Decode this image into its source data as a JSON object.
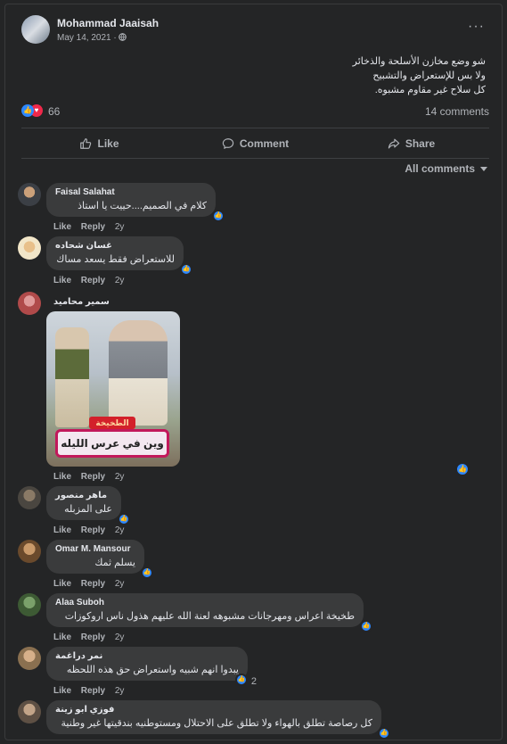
{
  "post": {
    "author": "Mohammad Jaaisah",
    "date": "May 14, 2021 · ",
    "globe_icon": "globe-icon",
    "more_label": "···",
    "lines": [
      "شو وضع مخازن الأسلحة والذخائر",
      "ولا بس للإستعراض والتشبيح",
      "كل سلاح غير مقاوم مشبوه."
    ],
    "reactions_count": "66",
    "comments_count": "14 comments"
  },
  "actions": {
    "like": "Like",
    "comment": "Comment",
    "share": "Share"
  },
  "filter": {
    "label": "All comments"
  },
  "comment_actions": {
    "like": "Like",
    "reply": "Reply",
    "time": "2y"
  },
  "comments": [
    {
      "name": "Faisal Salahat",
      "text": "كلام في الصميم....حييت يا استاذ"
    },
    {
      "name": "غسان شحاده",
      "text": "للاستعراض فقط يسعد مساك"
    },
    {
      "name": "سمير محاميد",
      "text": "",
      "image_text": "وين في عرس الليله",
      "image_badge": "الطخيخة"
    },
    {
      "name": "ماهر منصور",
      "text": "على المزبله"
    },
    {
      "name": "Omar M. Mansour",
      "text": "يسلم ثمك"
    },
    {
      "name": "Alaa Suboh",
      "text": "طخيخة اعراس ومهرجانات مشبوهه لعنة الله عليهم هذول ناس اروكوزات"
    },
    {
      "name": "نمر دراغمة",
      "text": "يبدوا انهم شبيه واستعراض حق هذه اللحظه",
      "reaction_count": "2"
    },
    {
      "name": "فوزي ابو زينة",
      "text": "كل رصاصة تطلق بالهواء ولا تطلق على الاحتلال ومستوطنيه بندقيتها غير وطنية"
    }
  ],
  "colors": {
    "background": "#242526",
    "bubble": "#3a3b3c",
    "like_blue": "#2d88ff",
    "love_red": "#f0284a",
    "muted_text": "#b0b3b8"
  }
}
